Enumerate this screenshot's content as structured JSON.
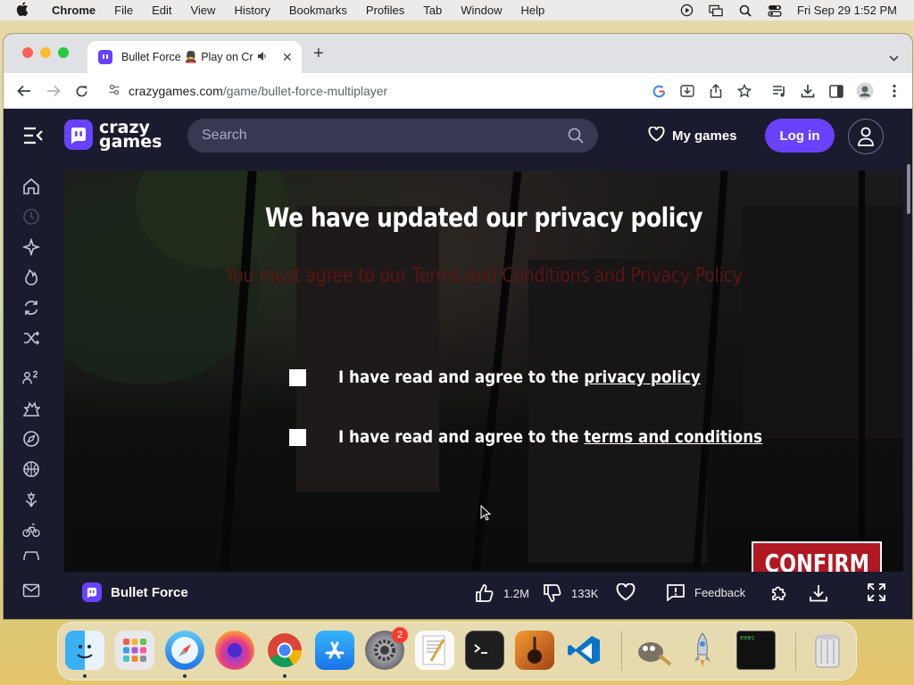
{
  "menubar": {
    "app_name": "Chrome",
    "menus": [
      "File",
      "Edit",
      "View",
      "History",
      "Bookmarks",
      "Profiles",
      "Tab",
      "Window",
      "Help"
    ],
    "clock": "Fri Sep 29  1:52 PM"
  },
  "browser": {
    "tab_title": "Bullet Force 💂 Play on Cr",
    "url_host": "crazygames.com",
    "url_path": "/game/bullet-force-multiplayer"
  },
  "site": {
    "logo_line1": "crazy",
    "logo_line2": "games",
    "search_placeholder": "Search",
    "my_games_label": "My games",
    "login_label": "Log in"
  },
  "game": {
    "title": "We have updated our privacy policy",
    "warning": "You must agree to our Terms and Conditions and Privacy Policy",
    "privacy_prefix": "I have read and agree to the ",
    "privacy_link": "privacy policy",
    "terms_prefix": "I have read and agree to the ",
    "terms_link": "terms and conditions",
    "confirm_label": "CONFIRM"
  },
  "gamebar": {
    "game_name": "Bullet Force",
    "likes": "1.2M",
    "dislikes": "133K",
    "feedback_label": "Feedback"
  },
  "dock": {
    "settings_badge": "2",
    "terminal_label": "exec"
  },
  "colors": {
    "brand_purple": "#6842ff",
    "page_bg": "#1b1b2f",
    "confirm_red": "#b01822",
    "warning_red": "#5b1515"
  }
}
